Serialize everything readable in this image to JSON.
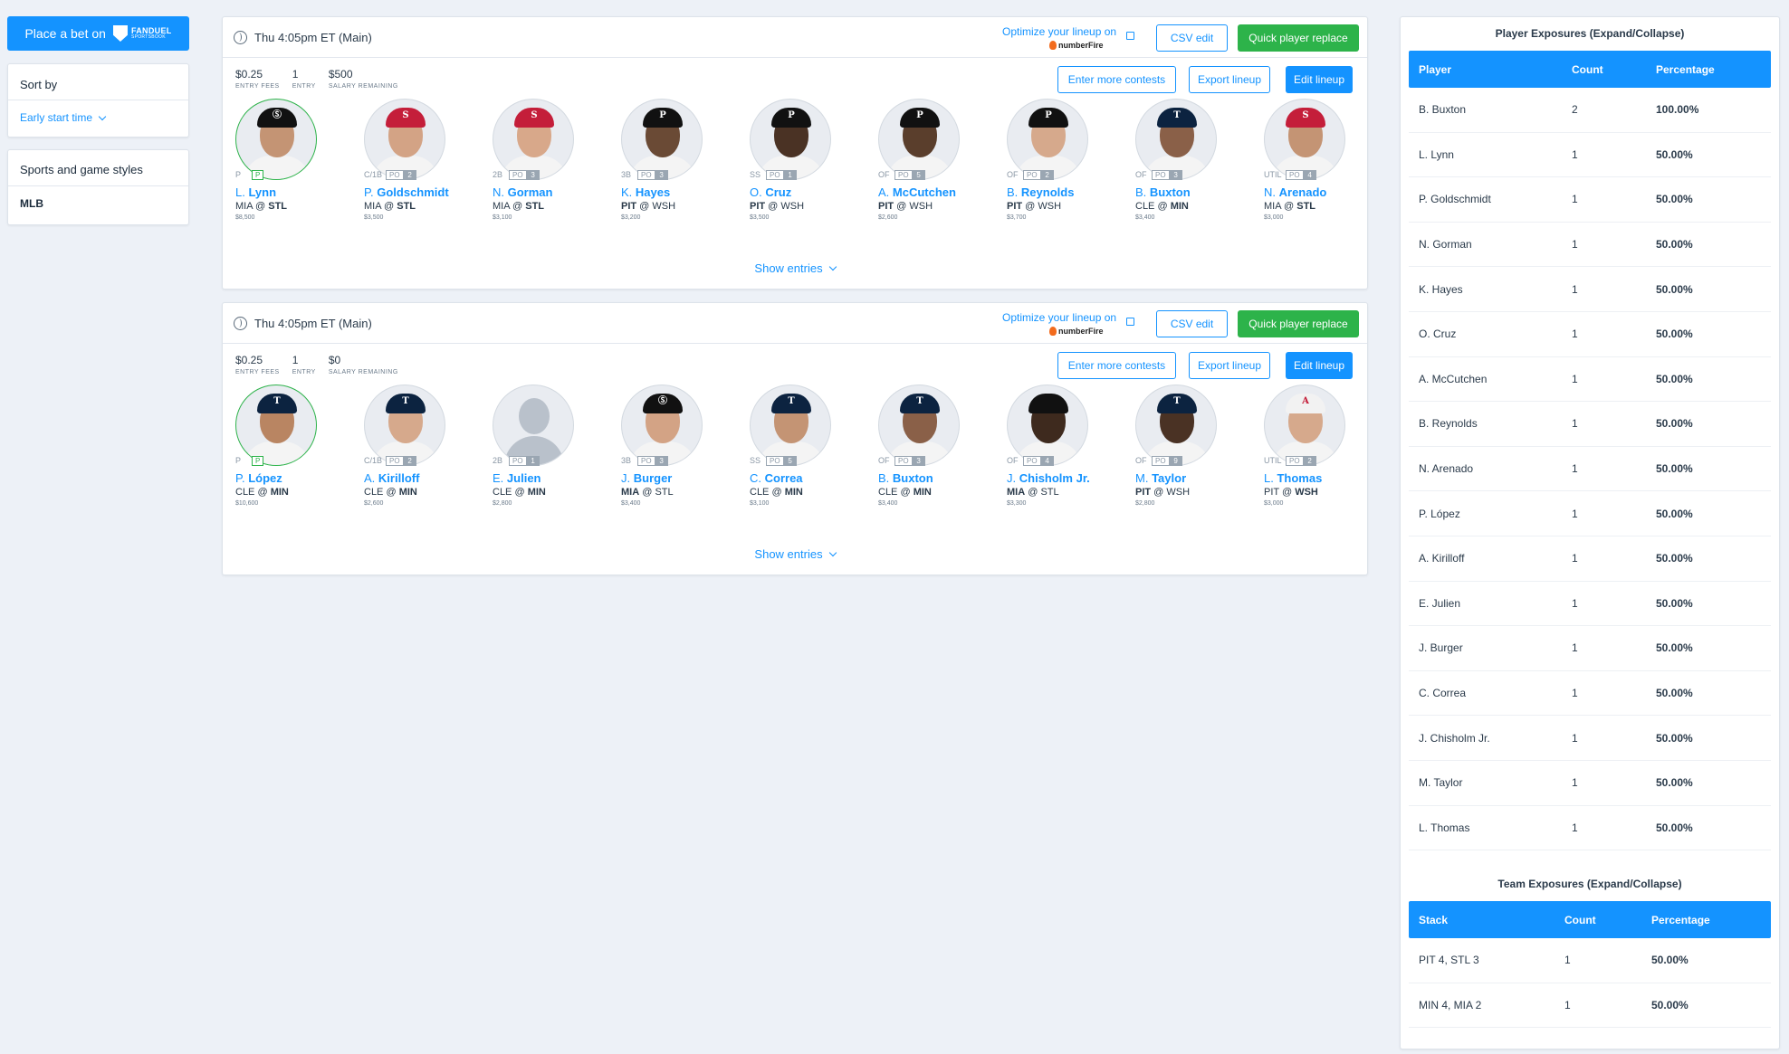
{
  "sidebar": {
    "bet_label": "Place a bet on",
    "brand_top": "FANDUEL",
    "brand_bottom": "SPORTSBOOK",
    "sort_label": "Sort by",
    "sort_value": "Early start time",
    "sports_label": "Sports and game styles",
    "sport_value": "MLB"
  },
  "common": {
    "optimize_text": "Optimize your lineup on",
    "numberfire": "numberFire",
    "csv_edit": "CSV edit",
    "quick_replace": "Quick player replace",
    "enter_more": "Enter more contests",
    "export": "Export lineup",
    "edit": "Edit lineup",
    "show_entries": "Show entries",
    "entry_fees_label": "ENTRY FEES",
    "entry_label": "ENTRY",
    "salary_label": "SALARY REMAINING"
  },
  "lineups": [
    {
      "time": "Thu 4:05pm ET (Main)",
      "entry_fees": "$0.25",
      "entries": "1",
      "salary_remaining": "$500",
      "players": [
        {
          "pos": "P",
          "tag": "P",
          "num": "",
          "first": "L.",
          "last": "Lynn",
          "away": "MIA",
          "home": "STL",
          "bold": "home",
          "salary": "$8,500",
          "cap": "#111111",
          "logo": "Ⓢ",
          "skin": "#c49474"
        },
        {
          "pos": "C/1B",
          "tag": "PO",
          "num": "2",
          "first": "P.",
          "last": "Goldschmidt",
          "away": "MIA",
          "home": "STL",
          "bold": "home",
          "salary": "$3,500",
          "cap": "#c41e3a",
          "logo": "S",
          "skin": "#d3a385"
        },
        {
          "pos": "2B",
          "tag": "PO",
          "num": "3",
          "first": "N.",
          "last": "Gorman",
          "away": "MIA",
          "home": "STL",
          "bold": "home",
          "salary": "$3,100",
          "cap": "#c41e3a",
          "logo": "S",
          "skin": "#d8a88a"
        },
        {
          "pos": "3B",
          "tag": "PO",
          "num": "3",
          "first": "K.",
          "last": "Hayes",
          "away": "PIT",
          "home": "WSH",
          "bold": "away",
          "salary": "$3,200",
          "cap": "#111111",
          "logo": "P",
          "skin": "#6a4a35"
        },
        {
          "pos": "SS",
          "tag": "PO",
          "num": "1",
          "first": "O.",
          "last": "Cruz",
          "away": "PIT",
          "home": "WSH",
          "bold": "away",
          "salary": "$3,500",
          "cap": "#111111",
          "logo": "P",
          "skin": "#4a3224"
        },
        {
          "pos": "OF",
          "tag": "PO",
          "num": "5",
          "first": "A.",
          "last": "McCutchen",
          "away": "PIT",
          "home": "WSH",
          "bold": "away",
          "salary": "$2,600",
          "cap": "#111111",
          "logo": "P",
          "skin": "#5a3e2c"
        },
        {
          "pos": "OF",
          "tag": "PO",
          "num": "2",
          "first": "B.",
          "last": "Reynolds",
          "away": "PIT",
          "home": "WSH",
          "bold": "away",
          "salary": "$3,700",
          "cap": "#111111",
          "logo": "P",
          "skin": "#d6a98c"
        },
        {
          "pos": "OF",
          "tag": "PO",
          "num": "3",
          "first": "B.",
          "last": "Buxton",
          "away": "CLE",
          "home": "MIN",
          "bold": "home",
          "salary": "$3,400",
          "cap": "#0c2340",
          "logo": "T",
          "skin": "#8a6048"
        },
        {
          "pos": "UTIL",
          "tag": "PO",
          "num": "4",
          "first": "N.",
          "last": "Arenado",
          "away": "MIA",
          "home": "STL",
          "bold": "home",
          "salary": "$3,000",
          "cap": "#c41e3a",
          "logo": "S",
          "skin": "#c49474"
        }
      ]
    },
    {
      "time": "Thu 4:05pm ET (Main)",
      "entry_fees": "$0.25",
      "entries": "1",
      "salary_remaining": "$0",
      "players": [
        {
          "pos": "P",
          "tag": "P",
          "num": "",
          "first": "P.",
          "last": "López",
          "away": "CLE",
          "home": "MIN",
          "bold": "home",
          "salary": "$10,600",
          "cap": "#0c2340",
          "logo": "T",
          "skin": "#b98562"
        },
        {
          "pos": "C/1B",
          "tag": "PO",
          "num": "2",
          "first": "A.",
          "last": "Kirilloff",
          "away": "CLE",
          "home": "MIN",
          "bold": "home",
          "salary": "$2,600",
          "cap": "#0c2340",
          "logo": "T",
          "skin": "#d6a98c"
        },
        {
          "pos": "2B",
          "tag": "PO",
          "num": "1",
          "first": "E.",
          "last": "Julien",
          "away": "CLE",
          "home": "MIN",
          "bold": "home",
          "salary": "$2,800",
          "cap": "",
          "logo": "",
          "skin": ""
        },
        {
          "pos": "3B",
          "tag": "PO",
          "num": "3",
          "first": "J.",
          "last": "Burger",
          "away": "MIA",
          "home": "STL",
          "bold": "away",
          "salary": "$3,400",
          "cap": "#111111",
          "logo": "Ⓢ",
          "skin": "#d3a385"
        },
        {
          "pos": "SS",
          "tag": "PO",
          "num": "5",
          "first": "C.",
          "last": "Correa",
          "away": "CLE",
          "home": "MIN",
          "bold": "home",
          "salary": "$3,100",
          "cap": "#0c2340",
          "logo": "T",
          "skin": "#c49474"
        },
        {
          "pos": "OF",
          "tag": "PO",
          "num": "3",
          "first": "B.",
          "last": "Buxton",
          "away": "CLE",
          "home": "MIN",
          "bold": "home",
          "salary": "$3,400",
          "cap": "#0c2340",
          "logo": "T",
          "skin": "#8a6048"
        },
        {
          "pos": "OF",
          "tag": "PO",
          "num": "4",
          "first": "J.",
          "last": "Chisholm Jr.",
          "away": "MIA",
          "home": "STL",
          "bold": "away",
          "salary": "$3,300",
          "cap": "#111111",
          "logo": "",
          "skin": "#3e2a1e"
        },
        {
          "pos": "OF",
          "tag": "PO",
          "num": "9",
          "first": "M.",
          "last": "Taylor",
          "away": "PIT",
          "home": "WSH",
          "bold": "away",
          "salary": "$2,800",
          "cap": "#0c2340",
          "logo": "T",
          "skin": "#4a3224"
        },
        {
          "pos": "UTIL",
          "tag": "PO",
          "num": "2",
          "first": "L.",
          "last": "Thomas",
          "away": "PIT",
          "home": "WSH",
          "bold": "home",
          "salary": "$3,000",
          "cap": "#f2f2f2",
          "logo": "A",
          "skin": "#d6a98c"
        }
      ]
    }
  ],
  "player_exposures": {
    "title": "Player Exposures (Expand/Collapse)",
    "headers": [
      "Player",
      "Count",
      "Percentage"
    ],
    "rows": [
      [
        "B. Buxton",
        "2",
        "100.00%"
      ],
      [
        "L. Lynn",
        "1",
        "50.00%"
      ],
      [
        "P. Goldschmidt",
        "1",
        "50.00%"
      ],
      [
        "N. Gorman",
        "1",
        "50.00%"
      ],
      [
        "K. Hayes",
        "1",
        "50.00%"
      ],
      [
        "O. Cruz",
        "1",
        "50.00%"
      ],
      [
        "A. McCutchen",
        "1",
        "50.00%"
      ],
      [
        "B. Reynolds",
        "1",
        "50.00%"
      ],
      [
        "N. Arenado",
        "1",
        "50.00%"
      ],
      [
        "P. López",
        "1",
        "50.00%"
      ],
      [
        "A. Kirilloff",
        "1",
        "50.00%"
      ],
      [
        "E. Julien",
        "1",
        "50.00%"
      ],
      [
        "J. Burger",
        "1",
        "50.00%"
      ],
      [
        "C. Correa",
        "1",
        "50.00%"
      ],
      [
        "J. Chisholm Jr.",
        "1",
        "50.00%"
      ],
      [
        "M. Taylor",
        "1",
        "50.00%"
      ],
      [
        "L. Thomas",
        "1",
        "50.00%"
      ]
    ]
  },
  "team_exposures": {
    "title": "Team Exposures (Expand/Collapse)",
    "headers": [
      "Stack",
      "Count",
      "Percentage"
    ],
    "rows": [
      [
        "PIT 4, STL 3",
        "1",
        "50.00%"
      ],
      [
        "MIN 4, MIA 2",
        "1",
        "50.00%"
      ]
    ]
  }
}
